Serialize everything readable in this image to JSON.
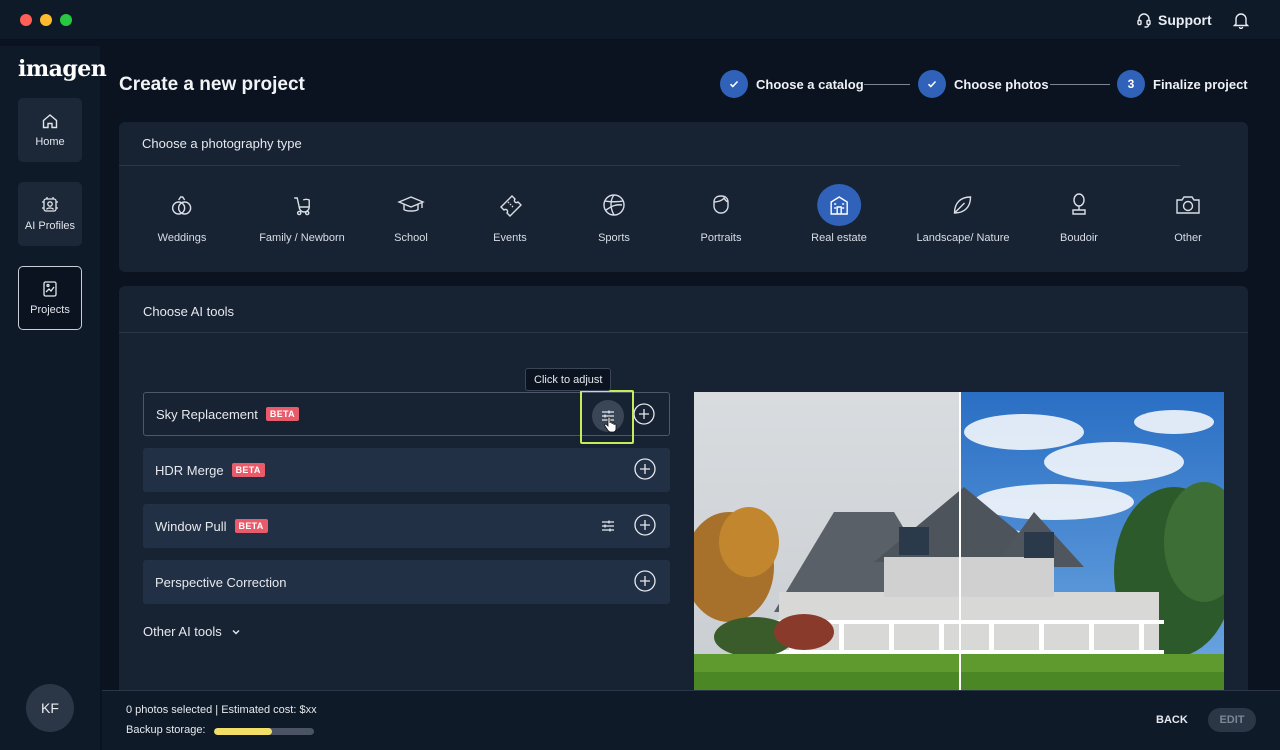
{
  "titlebar": {
    "support_label": "Support"
  },
  "sidebar": {
    "logo": "imagen",
    "items": [
      {
        "label": "Home",
        "icon": "home-icon"
      },
      {
        "label": "AI Profiles",
        "icon": "ai-profile-icon"
      },
      {
        "label": "Projects",
        "icon": "projects-icon"
      }
    ],
    "avatar_initials": "KF"
  },
  "header": {
    "title": "Create a new project",
    "steps": [
      {
        "label": "Choose a catalog",
        "status": "done"
      },
      {
        "label": "Choose photos",
        "status": "done"
      },
      {
        "label": "Finalize project",
        "number": "3",
        "status": "current"
      }
    ]
  },
  "photography": {
    "title": "Choose a photography type",
    "types": [
      {
        "label": "Weddings",
        "icon": "rings-icon"
      },
      {
        "label": "Family / Newborn",
        "icon": "stroller-icon"
      },
      {
        "label": "School",
        "icon": "graduation-cap-icon"
      },
      {
        "label": "Events",
        "icon": "ticket-icon"
      },
      {
        "label": "Sports",
        "icon": "ball-icon"
      },
      {
        "label": "Portraits",
        "icon": "portrait-icon"
      },
      {
        "label": "Real estate",
        "icon": "building-icon",
        "selected": true
      },
      {
        "label": "Landscape/ Nature",
        "icon": "leaf-icon"
      },
      {
        "label": "Boudoir",
        "icon": "mirror-icon"
      },
      {
        "label": "Other",
        "icon": "camera-icon"
      }
    ]
  },
  "ai_tools": {
    "title": "Choose AI tools",
    "tooltip": "Click to adjust",
    "tools": [
      {
        "label": "Sky Replacement",
        "beta": "BETA",
        "adjustable": true,
        "active": true
      },
      {
        "label": "HDR Merge",
        "beta": "BETA",
        "adjustable": false
      },
      {
        "label": "Window Pull",
        "beta": "BETA",
        "adjustable": true
      },
      {
        "label": "Perspective Correction",
        "adjustable": false
      }
    ],
    "other_label": "Other AI tools"
  },
  "footer": {
    "summary": "0 photos selected | Estimated cost: $xx",
    "backup_label": "Backup storage:",
    "backup_fraction": 0.58,
    "back_label": "BACK",
    "edit_label": "EDIT"
  },
  "colors": {
    "accent": "#2f62b8",
    "beta": "#e85b6a",
    "highlight": "#c6ec5a",
    "backup_fill": "#f1df68"
  }
}
